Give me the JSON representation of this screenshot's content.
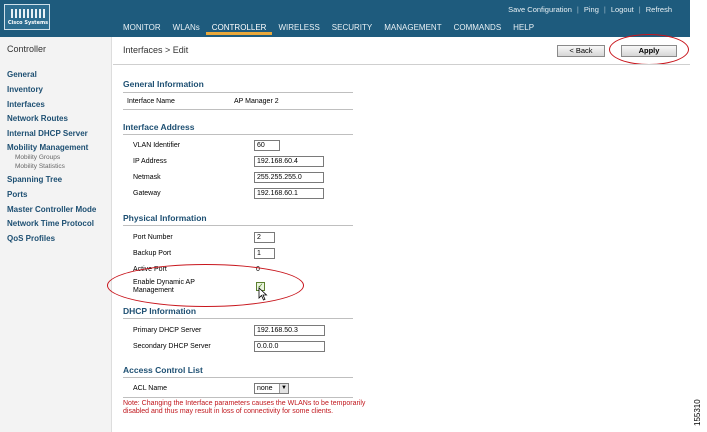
{
  "header": {
    "logo_text": "Cisco Systems",
    "links": [
      "Save Configuration",
      "Ping",
      "Logout",
      "Refresh"
    ],
    "nav": [
      "MONITOR",
      "WLANs",
      "CONTROLLER",
      "WIRELESS",
      "SECURITY",
      "MANAGEMENT",
      "COMMANDS",
      "HELP"
    ],
    "active_nav": "CONTROLLER"
  },
  "sidebar": {
    "title": "Controller",
    "items": [
      {
        "label": "General"
      },
      {
        "label": "Inventory"
      },
      {
        "label": "Interfaces"
      },
      {
        "label": "Network Routes"
      },
      {
        "label": "Internal DHCP Server"
      },
      {
        "label": "Mobility Management",
        "sub": [
          "Mobility Groups",
          "Mobility Statistics"
        ]
      },
      {
        "label": "Spanning Tree"
      },
      {
        "label": "Ports"
      },
      {
        "label": "Master Controller Mode"
      },
      {
        "label": "Network Time Protocol"
      },
      {
        "label": "QoS Profiles"
      }
    ]
  },
  "page": {
    "breadcrumb": "Interfaces > Edit",
    "back_label": "< Back",
    "apply_label": "Apply"
  },
  "general": {
    "title": "General Information",
    "interface_name_label": "Interface Name",
    "interface_name": "AP Manager 2"
  },
  "address": {
    "title": "Interface Address",
    "vlan_label": "VLAN Identifier",
    "vlan": "60",
    "ip_label": "IP Address",
    "ip": "192.168.60.4",
    "netmask_label": "Netmask",
    "netmask": "255.255.255.0",
    "gateway_label": "Gateway",
    "gateway": "192.168.60.1"
  },
  "physical": {
    "title": "Physical Information",
    "port_label": "Port Number",
    "port": "2",
    "backup_label": "Backup Port",
    "backup": "1",
    "active_label": "Active Port",
    "active": "0",
    "dyn_ap_label_1": "Enable Dynamic AP",
    "dyn_ap_label_2": "Management",
    "dyn_ap_checked": true
  },
  "dhcp": {
    "title": "DHCP Information",
    "primary_label": "Primary DHCP Server",
    "primary": "192.168.50.3",
    "secondary_label": "Secondary DHCP Server",
    "secondary": "0.0.0.0"
  },
  "acl": {
    "title": "Access Control List",
    "name_label": "ACL Name",
    "value": "none"
  },
  "note": "Note: Changing the Interface parameters causes the WLANs to be temporarily disabled and thus may result in loss of connectivity for some clients.",
  "figure_number": "155310",
  "colors": {
    "header_bg": "#1e5b7d",
    "nav_active_underline": "#e9a83b",
    "section_title": "#1d4f72",
    "note_text": "#c0171d",
    "annotation": "#c8161d"
  }
}
